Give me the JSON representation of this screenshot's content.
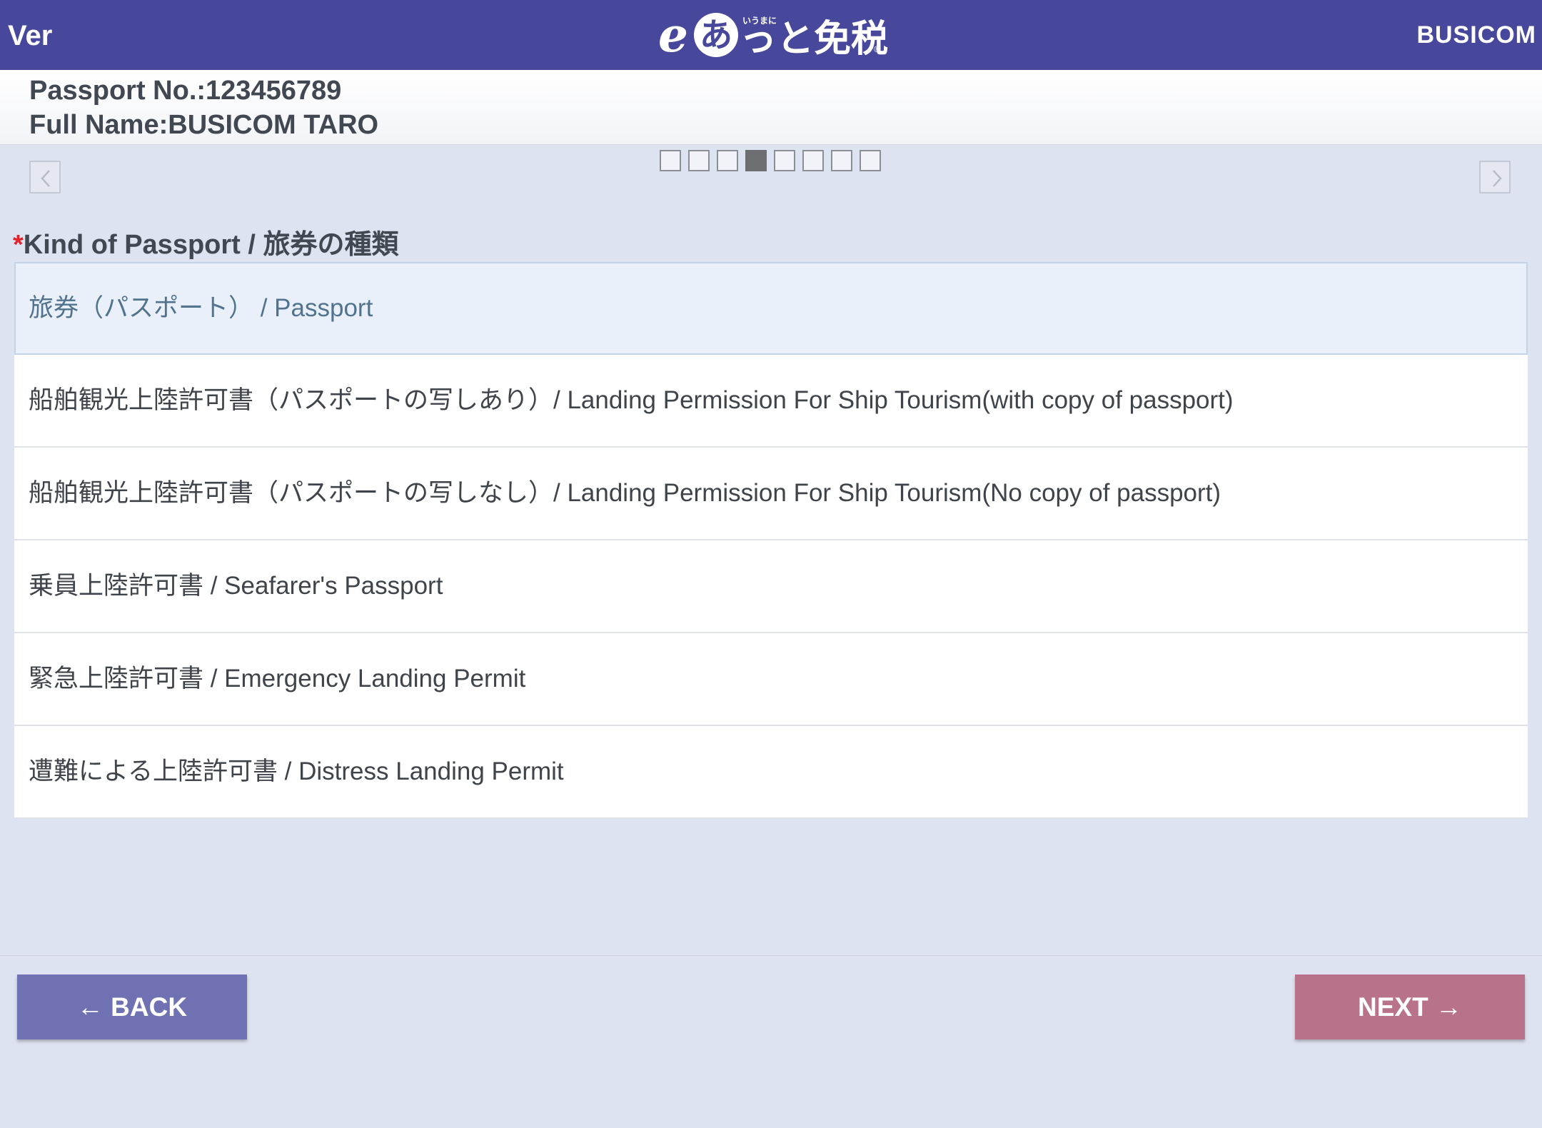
{
  "header": {
    "ver_label": "Ver",
    "logo": {
      "prefix": "e",
      "circle_char": "あ",
      "small_text": "いうまに",
      "main_text": "っと免税",
      "registered": "®"
    },
    "brand": "BUSICOM",
    "colors": {
      "background": "#47489b",
      "text": "#ffffff"
    }
  },
  "passport_info": {
    "passport_no_line": "Passport No.:123456789",
    "full_name_line": "Full Name:BUSICOM TARO"
  },
  "navigation": {
    "prev_icon": "chevron-left-icon",
    "next_icon": "chevron-right-icon"
  },
  "steps": {
    "total": 8,
    "current": 4
  },
  "field": {
    "required_mark": "*",
    "label": "Kind of Passport / 旅券の種類"
  },
  "options": [
    {
      "label": "旅券（パスポート） / Passport",
      "selected": true
    },
    {
      "label": "船舶観光上陸許可書（パスポートの写しあり）/ Landing Permission For Ship Tourism(with copy of passport)",
      "selected": false
    },
    {
      "label": "船舶観光上陸許可書（パスポートの写しなし）/ Landing Permission For Ship Tourism(No copy of passport)",
      "selected": false
    },
    {
      "label": "乗員上陸許可書 / Seafarer's Passport",
      "selected": false
    },
    {
      "label": "緊急上陸許可書 / Emergency Landing Permit",
      "selected": false
    },
    {
      "label": "遭難による上陸許可書 / Distress Landing Permit",
      "selected": false
    }
  ],
  "buttons": {
    "back_label": "← BACK",
    "next_label": "NEXT →",
    "back_color": "#7071b2",
    "next_color": "#b87289"
  }
}
